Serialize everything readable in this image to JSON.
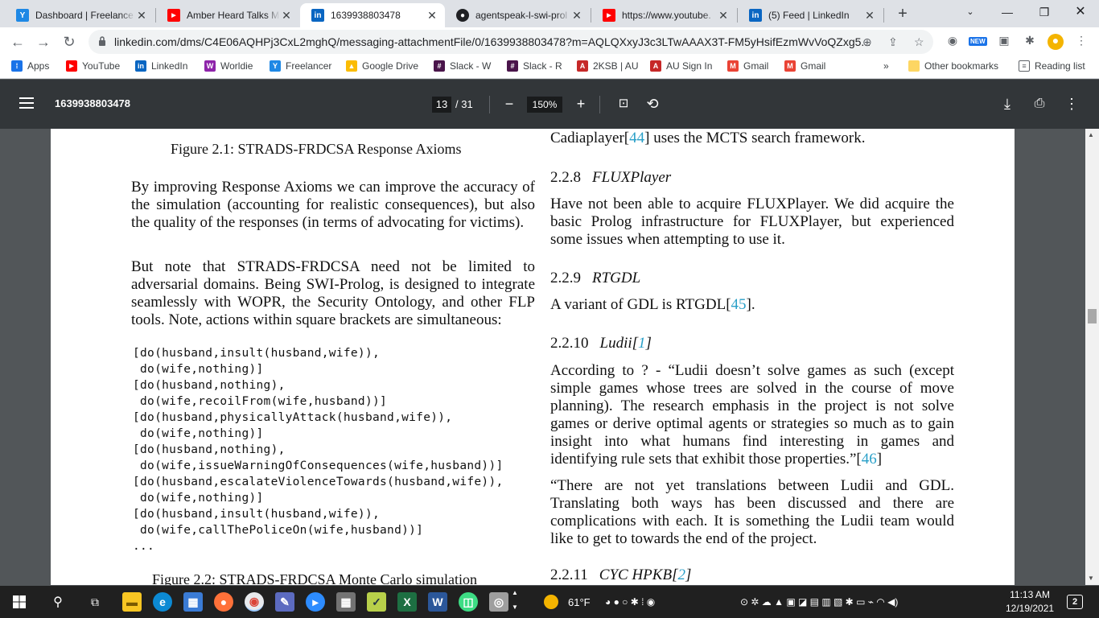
{
  "tabs": [
    {
      "title": "Dashboard | Freelance",
      "fav": "Y",
      "color": "#1e88e5"
    },
    {
      "title": "Amber Heard Talks Mu",
      "fav": "▶",
      "color": "#ff0000"
    },
    {
      "title": "1639938803478",
      "fav": "in",
      "color": "#0a66c2"
    },
    {
      "title": "agentspeak-l-swi-prol",
      "fav": "●",
      "color": "#202124"
    },
    {
      "title": "https://www.youtube.",
      "fav": "▶",
      "color": "#ff0000"
    },
    {
      "title": "(5) Feed | LinkedIn",
      "fav": "in",
      "color": "#0a66c2"
    }
  ],
  "url": "linkedin.com/dms/C4E06AQHPj3CxL2mghQ/messaging-attachmentFile/0/1639938803478?m=AQLQXxyJ3c3LTwAAAX3T-FM5yHsifEzmWvVoQZxg5...",
  "new_badge": "NEW",
  "bookmarks": [
    {
      "label": "Apps",
      "fav": "⁞⁞",
      "color": "#1a73e8"
    },
    {
      "label": "YouTube",
      "fav": "▶",
      "color": "#ff0000"
    },
    {
      "label": "LinkedIn",
      "fav": "in",
      "color": "#0a66c2"
    },
    {
      "label": "Worldie",
      "fav": "W",
      "color": "#8e24aa"
    },
    {
      "label": "Freelancer",
      "fav": "Y",
      "color": "#1e88e5"
    },
    {
      "label": "Google Drive",
      "fav": "▲",
      "color": "#fbbc04"
    },
    {
      "label": "Slack - W",
      "fav": "#",
      "color": "#4a154b"
    },
    {
      "label": "Slack - R",
      "fav": "#",
      "color": "#4a154b"
    },
    {
      "label": "2KSB | AU",
      "fav": "A",
      "color": "#c62828"
    },
    {
      "label": "AU Sign In",
      "fav": "A",
      "color": "#c62828"
    },
    {
      "label": "Gmail",
      "fav": "M",
      "color": "#ea4335"
    },
    {
      "label": "Gmail",
      "fav": "M",
      "color": "#ea4335"
    }
  ],
  "bookmarks_overflow": "»",
  "other_bookmarks": "Other bookmarks",
  "reading_list": "Reading list",
  "pdf": {
    "filename": "1639938803478",
    "page_current": "13",
    "page_total": "/ 31",
    "zoom": "150%"
  },
  "doc": {
    "fig1_caption": "Figure 2.1: STRADS-FRDCSA Response Axioms",
    "para1": "By improving Response Axioms we can improve the accuracy of the simulation (accounting for realistic consequences), but also the quality of the responses (in terms of advocating for victims).",
    "para2": "But note that STRADS-FRDCSA need not be limited to adversarial domains. Being SWI-Prolog, is designed to integrate seamlessly with WOPR, the Security Ontology, and other FLP tools. Note, actions within square brackets are simultaneous:",
    "code": "[do(husband,insult(husband,wife)),\n do(wife,nothing)]\n[do(husband,nothing),\n do(wife,recoilFrom(wife,husband))]\n[do(husband,physicallyAttack(husband,wife)),\n do(wife,nothing)]\n[do(husband,nothing),\n do(wife,issueWarningOfConsequences(wife,husband))]\n[do(husband,escalateViolenceTowards(husband,wife)),\n do(wife,nothing)]\n[do(husband,insult(husband,wife)),\n do(wife,callThePoliceOn(wife,husband))]\n...",
    "fig2_caption": "Figure 2.2: STRADS-FRDCSA Monte Carlo simulation",
    "r_line1_a": "Cadiaplayer[",
    "r_line1_ref": "44",
    "r_line1_b": "] uses the MCTS search framework.",
    "s228_num": "2.2.8",
    "s228_title": "FLUXPlayer",
    "s228_text": "Have not been able to acquire FLUXPlayer. We did acquire the basic Prolog infrastructure for FLUXPlayer, but experienced some issues when attempting to use it.",
    "s229_num": "2.2.9",
    "s229_title": "RTGDL",
    "s229_text_a": "A variant of GDL is RTGDL[",
    "s229_ref": "45",
    "s229_text_b": "].",
    "s2210_num": "2.2.10",
    "s2210_title_a": "Ludii[",
    "s2210_ref": "1",
    "s2210_title_b": "]",
    "s2210_text_a": "According to ? - “Ludii doesn’t solve games as such (except simple games whose trees are solved in the course of move planning). The research emphasis in the project is not solve games or derive optimal agents or strategies so much as to gain insight into what humans find interesting in games and identifying rule sets that exhibit those properties.”[",
    "s2210_ref2": "46",
    "s2210_text_b": "]",
    "s2210_quote": "“There are not yet translations between Ludii and GDL. Translating both ways has been discussed and there are complications with each. It is something the Ludii team would like to get to towards the end of the project.",
    "s2211_num": "2.2.11",
    "s2211_title_a": "CYC HPKB[",
    "s2211_ref": "2",
    "s2211_title_b": "]"
  },
  "taskbar": {
    "weather": "61°F",
    "time": "11:13 AM",
    "date": "12/19/2021",
    "notif_count": "2"
  }
}
